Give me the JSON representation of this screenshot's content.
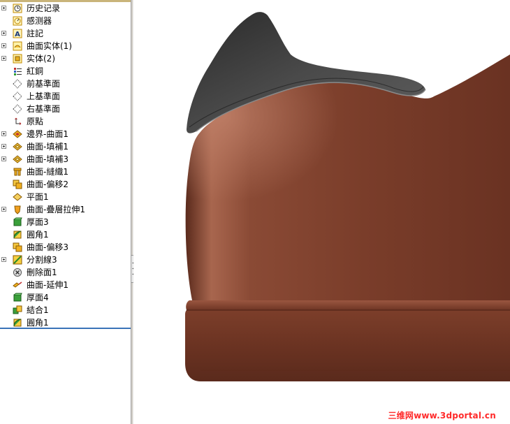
{
  "feature_tree": {
    "items": [
      {
        "label": "历史记录",
        "icon": "history-icon",
        "expandable": true
      },
      {
        "label": "感测器",
        "icon": "sensor-icon",
        "expandable": false
      },
      {
        "label": "註記",
        "icon": "annotation-icon",
        "expandable": true
      },
      {
        "label": "曲面实体(1)",
        "icon": "surface-bodies-icon",
        "expandable": true
      },
      {
        "label": "实体(2)",
        "icon": "solid-bodies-icon",
        "expandable": true
      },
      {
        "label": "紅銅",
        "icon": "material-icon",
        "expandable": false
      },
      {
        "label": "前基準面",
        "icon": "plane-icon",
        "expandable": false
      },
      {
        "label": "上基準面",
        "icon": "plane-icon",
        "expandable": false
      },
      {
        "label": "右基準面",
        "icon": "plane-icon",
        "expandable": false
      },
      {
        "label": "原點",
        "icon": "origin-icon",
        "expandable": false
      },
      {
        "label": "邊界-曲面1",
        "icon": "boundary-surface-icon",
        "expandable": true
      },
      {
        "label": "曲面-填補1",
        "icon": "filled-surface-icon",
        "expandable": true
      },
      {
        "label": "曲面-填補3",
        "icon": "filled-surface-icon",
        "expandable": true
      },
      {
        "label": "曲面-縫織1",
        "icon": "knit-surface-icon",
        "expandable": false
      },
      {
        "label": "曲面-偏移2",
        "icon": "offset-surface-icon",
        "expandable": false
      },
      {
        "label": "平面1",
        "icon": "planar-surface-icon",
        "expandable": false
      },
      {
        "label": "曲面-疊層拉伸1",
        "icon": "loft-surface-icon",
        "expandable": true
      },
      {
        "label": "厚面3",
        "icon": "thicken-icon",
        "expandable": false
      },
      {
        "label": "圓角1",
        "icon": "fillet-icon",
        "expandable": false
      },
      {
        "label": "曲面-偏移3",
        "icon": "offset-surface-icon",
        "expandable": false
      },
      {
        "label": "分割線3",
        "icon": "split-line-icon",
        "expandable": true
      },
      {
        "label": "刪除面1",
        "icon": "delete-face-icon",
        "expandable": false
      },
      {
        "label": "曲面-延伸1",
        "icon": "extend-surface-icon",
        "expandable": false
      },
      {
        "label": "厚面4",
        "icon": "thicken-icon",
        "expandable": false
      },
      {
        "label": "結合1",
        "icon": "combine-icon",
        "expandable": false
      },
      {
        "label": "圓角1",
        "icon": "fillet-icon",
        "expandable": false
      }
    ]
  },
  "viewport": {
    "model_colors": {
      "body": "#7a3f2c",
      "collar": "#3a3a3a",
      "sole": "#6e3524"
    }
  },
  "watermark": {
    "text": "三维网www.3dportal.cn"
  },
  "colors": {
    "accent": "#3a73b8",
    "watermark": "#ff2a2a"
  }
}
